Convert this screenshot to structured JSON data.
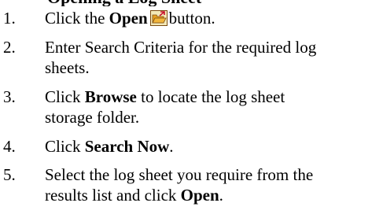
{
  "heading": "Opening a Log Sheet",
  "steps": [
    {
      "number": "1.",
      "parts": [
        {
          "text": "Click the ",
          "bold": false
        },
        {
          "text": "Open",
          "bold": true
        },
        {
          "icon": "open-folder-icon"
        },
        {
          "text": "button.",
          "bold": false
        }
      ]
    },
    {
      "number": "2.",
      "lines": [
        "Enter Search Criteria for the required log",
        "sheets."
      ]
    },
    {
      "number": "3.",
      "parts": [
        {
          "text": "Click ",
          "bold": false
        },
        {
          "text": "Browse",
          "bold": true
        },
        {
          "text": " to locate the log sheet",
          "bold": false
        }
      ],
      "line2": "storage folder."
    },
    {
      "number": "4.",
      "parts": [
        {
          "text": "Click ",
          "bold": false
        },
        {
          "text": "Search Now",
          "bold": true
        },
        {
          "text": ".",
          "bold": false
        }
      ]
    },
    {
      "number": "5.",
      "line1": "Select the log sheet you require from the",
      "parts2": [
        {
          "text": "results list and click ",
          "bold": false
        },
        {
          "text": "Open",
          "bold": true
        },
        {
          "text": ".",
          "bold": false
        }
      ]
    }
  ],
  "colors": {
    "icon_folder": "#e8a020",
    "icon_border": "#7a4a10",
    "icon_background": "#f4e9b8",
    "icon_arrow": "#c8102e"
  }
}
